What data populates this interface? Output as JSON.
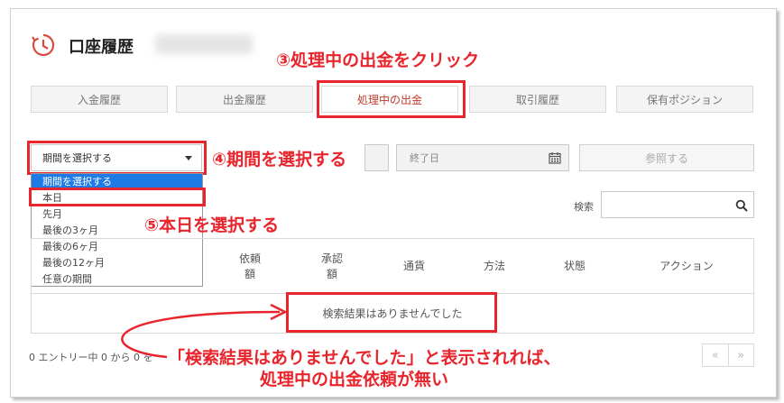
{
  "page": {
    "title": "口座履歴"
  },
  "tabs": [
    {
      "label": "入金履歴"
    },
    {
      "label": "出金履歴"
    },
    {
      "label": "処理中の出金"
    },
    {
      "label": "取引履歴"
    },
    {
      "label": "保有ポジション"
    }
  ],
  "filter": {
    "period_select": "期間を選択する",
    "options": [
      "期間を選択する",
      "本日",
      "先月",
      "最後の3ヶ月",
      "最後の6ヶ月",
      "最後の12ヶ月",
      "任意の期間"
    ],
    "highlighted_index": 0,
    "end_date_placeholder": "終了日",
    "view_button": "参照する"
  },
  "search": {
    "label": "検索",
    "value": ""
  },
  "table": {
    "columns": [
      {
        "lines": [
          "依頼",
          "額"
        ]
      },
      {
        "lines": [
          "承認",
          "額"
        ]
      },
      {
        "lines": [
          "通貨"
        ]
      },
      {
        "lines": [
          "方法"
        ]
      },
      {
        "lines": [
          "状態"
        ]
      },
      {
        "lines": [
          "アクション"
        ]
      }
    ],
    "empty_message": "検索結果はありませんでした"
  },
  "footer": {
    "summary": "0 エントリー中 0 から 0 を"
  },
  "pager": {
    "prev": "«",
    "next": "»"
  },
  "annotations": {
    "step3": "③処理中の出金をクリック",
    "step4": "④期間を選択する",
    "step5": "⑤本日を選択する",
    "note_line1": "「検索結果はありませんでした」と表示されれば、",
    "note_line2": "処理中の出金依頼が無い"
  },
  "colors": {
    "annotation_red": "#e8252c",
    "accent_red": "#c0392b",
    "highlight_blue": "#1e7be6"
  }
}
